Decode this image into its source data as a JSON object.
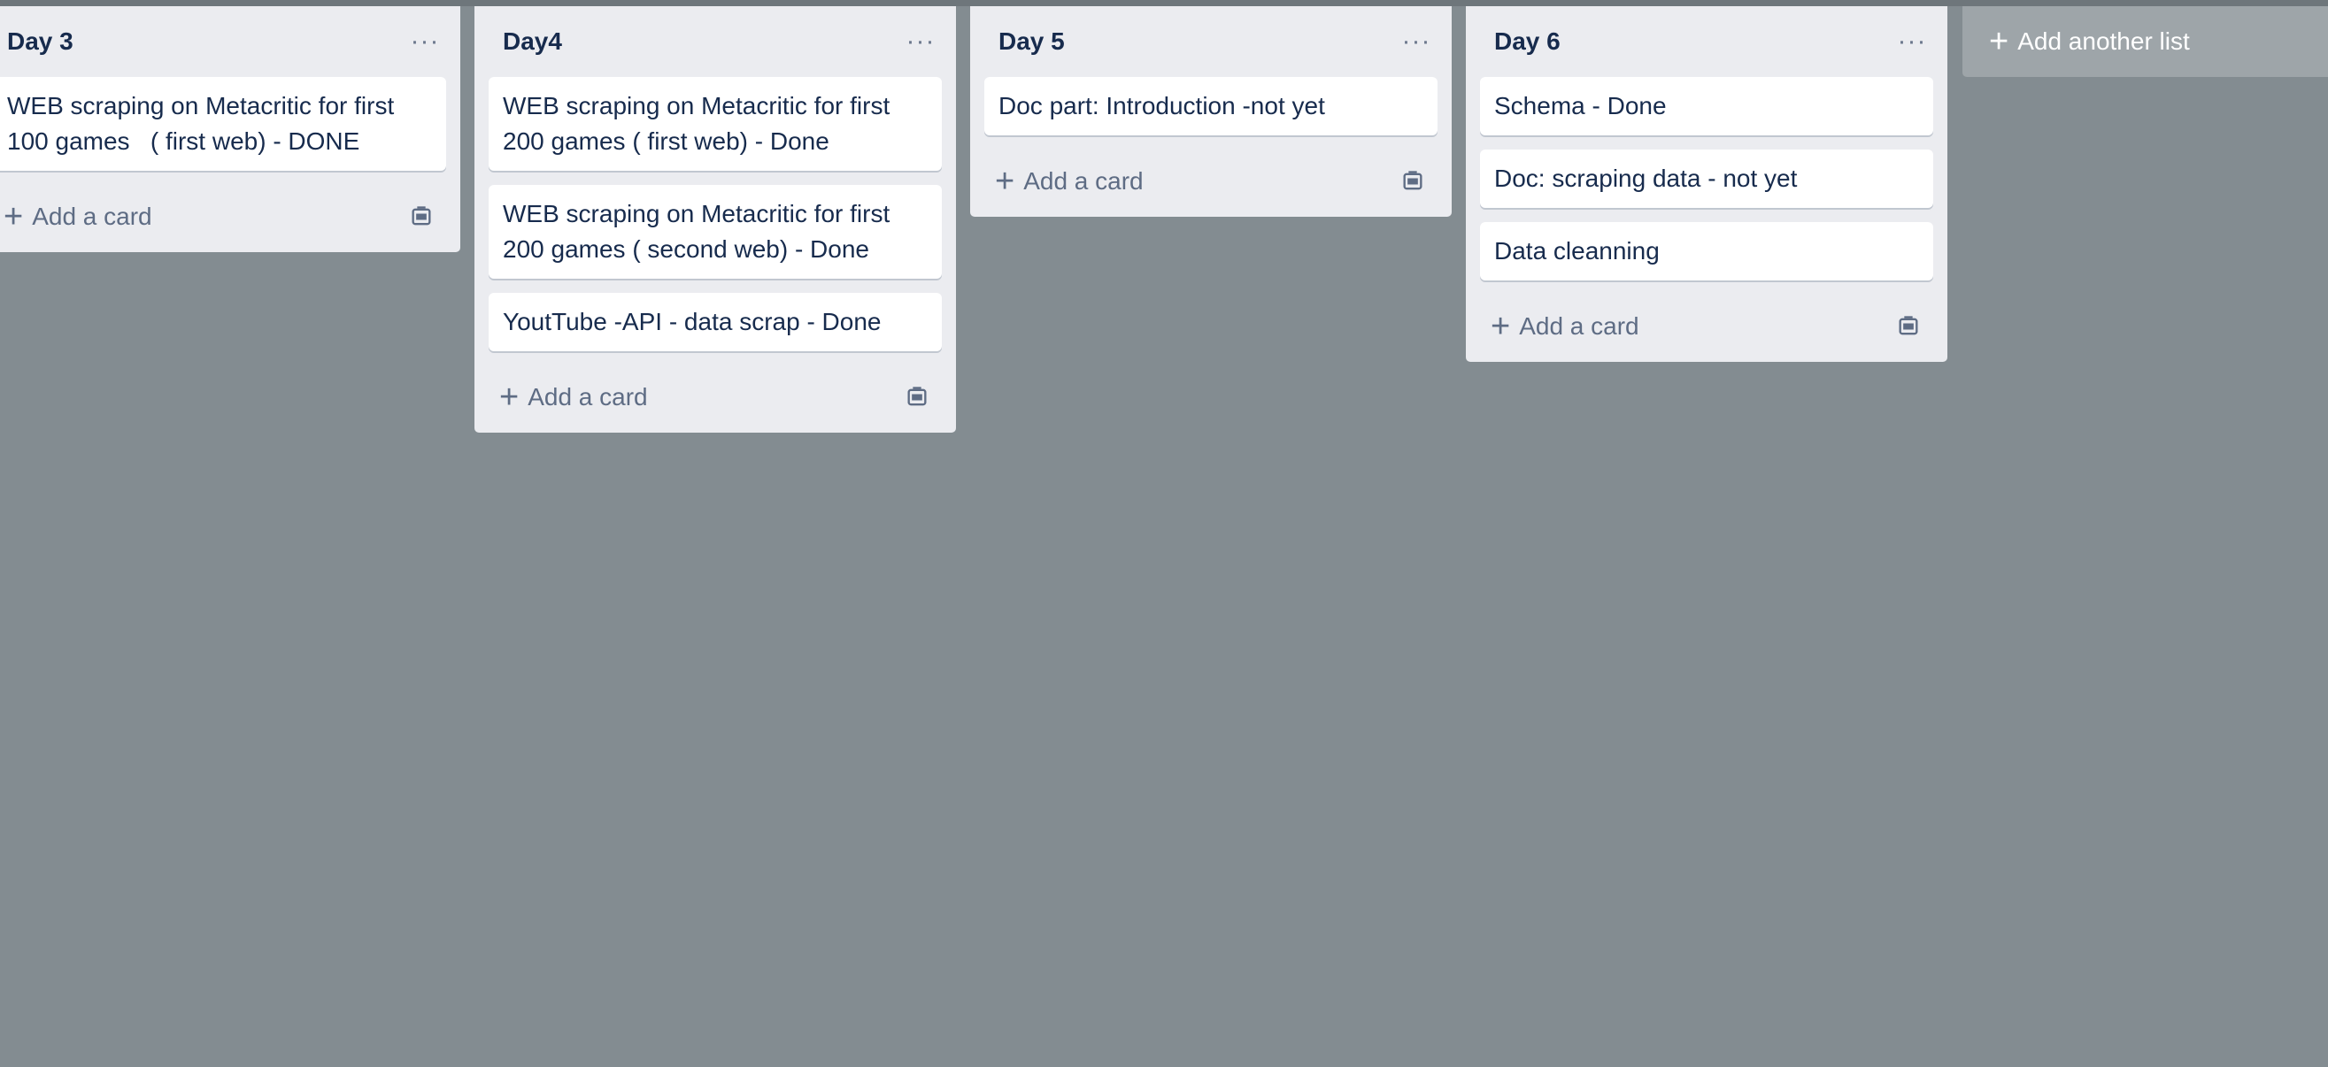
{
  "lists": [
    {
      "title": "Day 3",
      "menu_icon": "ellipsis-icon",
      "cards": [
        "WEB scraping on Metacritic for first 100 games   ( first web) - DONE"
      ],
      "add_card_label": "Add a card"
    },
    {
      "title": "Day4",
      "menu_icon": "ellipsis-icon",
      "cards": [
        "WEB scraping on Metacritic for first 200 games ( first web) - Done",
        "WEB scraping on Metacritic for first 200 games ( second web) - Done",
        "YoutTube -API - data scrap - Done"
      ],
      "add_card_label": "Add a card"
    },
    {
      "title": "Day 5",
      "menu_icon": "ellipsis-icon",
      "cards": [
        "Doc part: Introduction -not yet"
      ],
      "add_card_label": "Add a card"
    },
    {
      "title": "Day 6",
      "menu_icon": "ellipsis-icon",
      "cards": [
        "Schema - Done",
        "Doc: scraping data - not yet",
        "Data cleanning"
      ],
      "add_card_label": "Add a card"
    }
  ],
  "add_list_label": "Add another list",
  "colors": {
    "board_background": "#838c91",
    "list_background": "#ebecf0",
    "card_text": "#172b4d",
    "muted_text": "#5e6c84"
  }
}
